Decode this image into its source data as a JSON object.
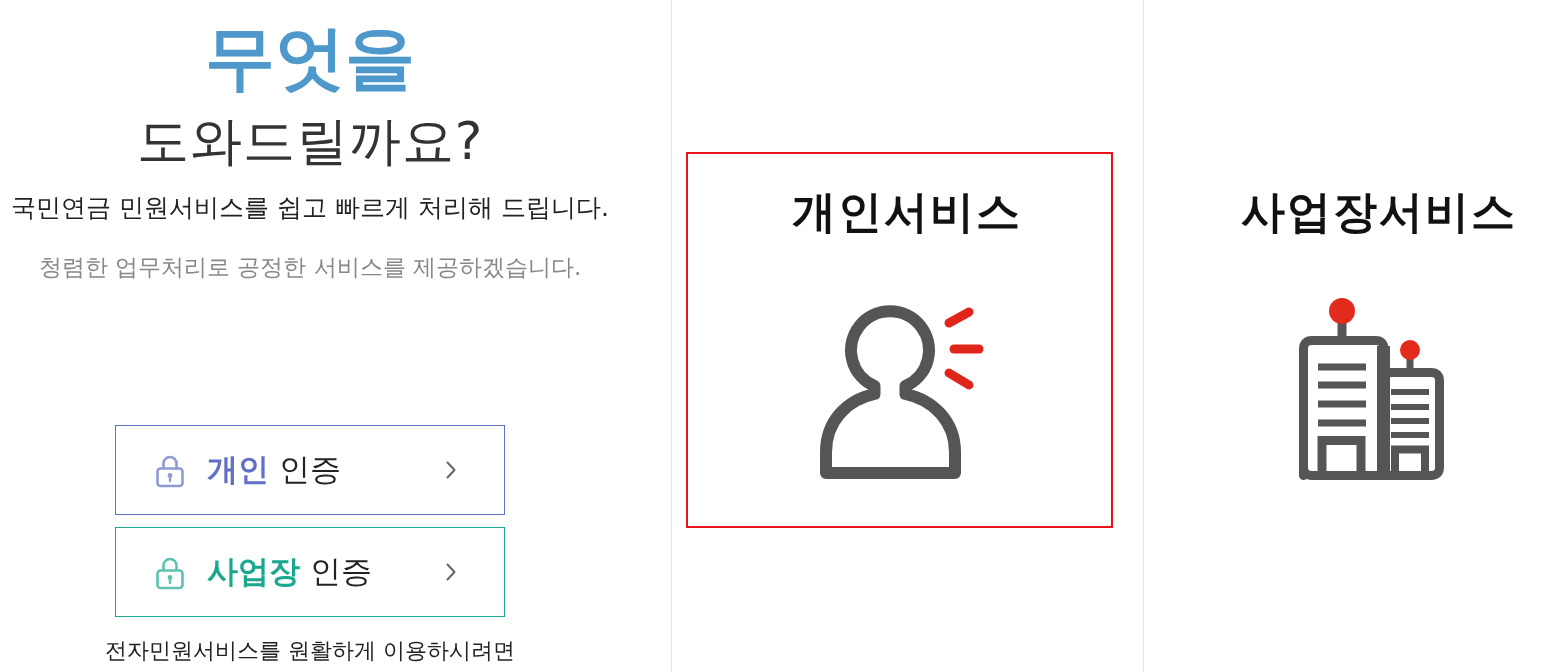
{
  "heading": {
    "highlight": "무엇을",
    "title": "도와드릴까요?"
  },
  "intro": "국민연금 민원서비스를 쉽고 빠르게 처리해 드립니다.",
  "motto": "청렴한 업무처리로 공정한 서비스를 제공하겠습니다.",
  "auth_buttons": [
    {
      "label": "**개인** 인증",
      "color": "#6270c4"
    },
    {
      "label": "**사업장** 인증",
      "color": "#1aa98f"
    }
  ],
  "notice": "전자민원서비스를 원활하게 이용하시려면",
  "services": [
    {
      "kind": "personal",
      "title": "개인서비스",
      "selected": true
    },
    {
      "kind": "business",
      "title": "사업장서비스",
      "selected": false
    }
  ]
}
